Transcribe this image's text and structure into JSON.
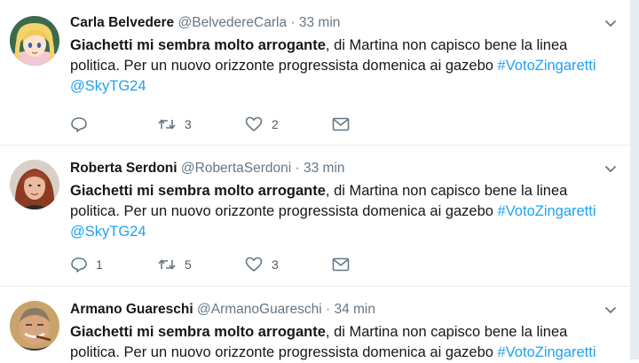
{
  "tweets": [
    {
      "name": "Carla Belvedere",
      "handle": "@BelvedereCarla",
      "separator": "·",
      "time": "33 min",
      "text_bold": "Giachetti mi sembra molto arrogante",
      "text_rest": ", di Martina non capisco bene la linea politica. Per un nuovo orizzonte progressista domenica ai gazebo ",
      "hashtag": "#VotoZingaretti",
      "mention": "@SkyTG24",
      "reply_count": "",
      "retweet_count": "3",
      "like_count": "2",
      "avatar": "cartoon-girl-blonde"
    },
    {
      "name": "Roberta Serdoni",
      "handle": "@RobertaSerdoni",
      "separator": "·",
      "time": "33 min",
      "text_bold": "Giachetti mi sembra molto arrogante",
      "text_rest": ", di Martina non capisco bene la linea politica. Per un nuovo orizzonte progressista domenica ai gazebo ",
      "hashtag": "#VotoZingaretti",
      "mention": "@SkyTG24",
      "reply_count": "1",
      "retweet_count": "5",
      "like_count": "3",
      "avatar": "woman-red-hair"
    },
    {
      "name": "Armano Guareschi",
      "handle": "@ArmanoGuareschi",
      "separator": "·",
      "time": "34 min",
      "text_bold": "Giachetti mi sembra molto arrogante",
      "text_rest": ", di Martina non capisco bene la linea politica. Per un nuovo orizzonte progressista domenica ai gazebo ",
      "hashtag": "#VotoZingaretti",
      "mention": "",
      "reply_count": "",
      "retweet_count": "",
      "like_count": "",
      "avatar": "old-man-cigar"
    }
  ],
  "colors": {
    "link": "#1da1f2",
    "secondary": "#657786",
    "divider": "#e6ecf0"
  },
  "icons": [
    "chevron-down-icon",
    "reply-icon",
    "retweet-icon",
    "like-icon",
    "direct-message-icon"
  ]
}
